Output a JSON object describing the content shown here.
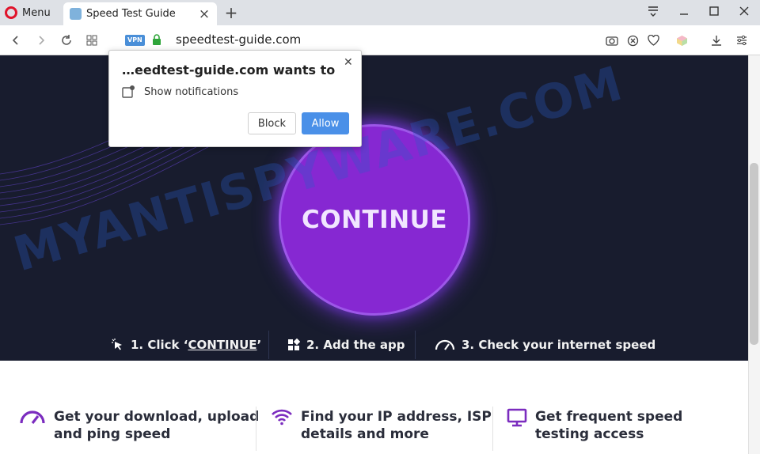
{
  "browser": {
    "menu_label": "Menu",
    "tab_title": "Speed Test Guide",
    "url": "speedtest-guide.com",
    "vpn_label": "VPN"
  },
  "popup": {
    "title": "…eedtest-guide.com wants to",
    "permission": "Show notifications",
    "block_label": "Block",
    "allow_label": "Allow"
  },
  "hero": {
    "continue_label": "CONTINUE",
    "step1_prefix": "1. Click ‘",
    "step1_link": "CONTINUE",
    "step1_suffix": "’",
    "step2": "2. Add the app",
    "step3": "3. Check your internet speed"
  },
  "features": [
    {
      "line1": "Get your download, upload",
      "line2": "and ping speed",
      "icon": "speedometer-icon"
    },
    {
      "line1": "Find your IP address, ISP",
      "line2": "details and more",
      "icon": "wifi-icon"
    },
    {
      "line1": "Get frequent speed",
      "line2": "testing access",
      "icon": "monitor-icon"
    }
  ],
  "watermark": "MYANTISPYWARE.COM",
  "colors": {
    "accent_purple": "#8628d2",
    "hero_bg": "#181c2e",
    "allow_blue": "#4a90e8",
    "opera_red": "#e0142b"
  }
}
